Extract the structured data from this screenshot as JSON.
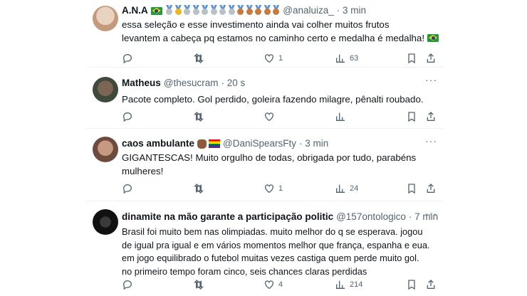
{
  "tweets": [
    {
      "name": "A.N.A",
      "handle": "@analuiza_",
      "time": "· 3 min",
      "text": "essa seleção e esse investimento ainda vai colher muitos frutos\nlevantem a cabeça pq estamos no caminho certo e medalha é medalha!",
      "likes": "1",
      "views": "63",
      "avatar_color": "#d9c3b0"
    },
    {
      "name": "Matheus",
      "handle": "@thesucram",
      "time": "· 20 s",
      "text": "Pacote completo. Gol perdido, goleira fazendo milagre, pênalti roubado.",
      "likes": "",
      "views": "",
      "avatar_color": "#6b5a4a"
    },
    {
      "name": "caos ambulante",
      "handle": "@DaniSpearsFty",
      "time": "· 3 min",
      "text": "GIGANTESCAS! Muito orgulho de todas, obrigada por tudo, parabéns\nmulheres!",
      "likes": "1",
      "views": "24",
      "avatar_color": "#b58b74"
    },
    {
      "name": "dinamite na mão garante a participação politic",
      "handle": "@157ontologico",
      "time": "· 7 min",
      "text": "Brasil foi muito bem nas olimpiadas. muito melhor do q se esperava. jogou\nde igual pra igual e em vários momentos melhor que frança, espanha e eua.\nem jogo equilibrado o futebol muitas vezes castiga quem perde muito gol.\nno primeiro tempo foram cinco, seis chances claras perdidas",
      "likes": "4",
      "views": "214",
      "avatar_color": "#1a1a1a"
    }
  ],
  "medals": [
    "silver",
    "gold",
    "silver",
    "silver",
    "silver",
    "silver",
    "silver",
    "silver",
    "bronze",
    "bronze",
    "bronze",
    "bronze",
    "bronze"
  ],
  "colors": {
    "gold": "#e8b923",
    "silver": "#b8c0c8",
    "bronze": "#c97a3a",
    "muted_text": "#536471",
    "separator": "#eff3f4"
  },
  "icons": [
    "reply-icon",
    "retweet-icon",
    "like-icon",
    "views-icon",
    "bookmark-icon",
    "share-icon",
    "more-icon"
  ]
}
